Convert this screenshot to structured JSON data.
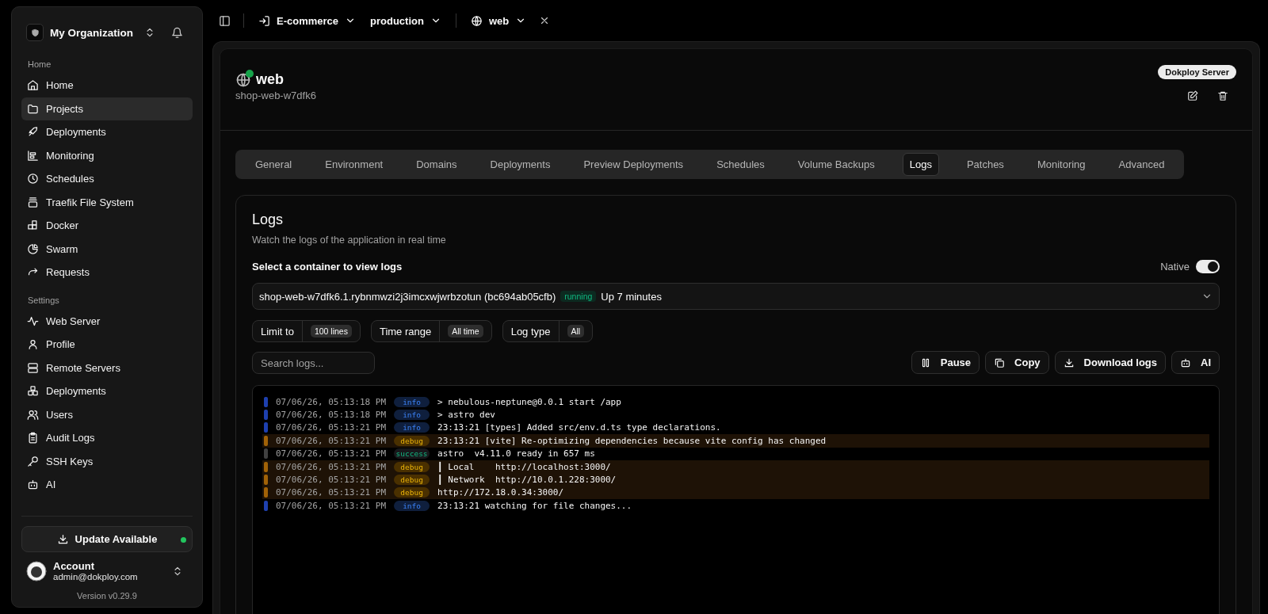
{
  "sidebar": {
    "organization": "My Organization",
    "sections": [
      {
        "title": "Home",
        "items": [
          {
            "label": "Home",
            "selected": false
          },
          {
            "label": "Projects",
            "selected": true
          },
          {
            "label": "Deployments",
            "selected": false
          },
          {
            "label": "Monitoring",
            "selected": false
          },
          {
            "label": "Schedules",
            "selected": false
          },
          {
            "label": "Traefik File System",
            "selected": false
          },
          {
            "label": "Docker",
            "selected": false
          },
          {
            "label": "Swarm",
            "selected": false
          },
          {
            "label": "Requests",
            "selected": false
          }
        ]
      },
      {
        "title": "Settings",
        "items": [
          {
            "label": "Web Server",
            "selected": false
          },
          {
            "label": "Profile",
            "selected": false
          },
          {
            "label": "Remote Servers",
            "selected": false
          },
          {
            "label": "Deployments",
            "selected": false
          },
          {
            "label": "Users",
            "selected": false
          },
          {
            "label": "Audit Logs",
            "selected": false
          },
          {
            "label": "SSH Keys",
            "selected": false
          },
          {
            "label": "AI",
            "selected": false
          }
        ]
      }
    ],
    "update": {
      "label": "Update Available",
      "dot": true
    },
    "account": {
      "name": "Account",
      "email": "admin@dokploy.com"
    },
    "version": "Version v0.29.9"
  },
  "breadcrumb": {
    "project": "E-commerce",
    "environment": "production",
    "service": "web"
  },
  "service": {
    "name": "web",
    "running": true,
    "app_name": "shop-web-w7dfk6",
    "server_badge": "Dokploy Server"
  },
  "tabs": [
    {
      "label": "General",
      "selected": false
    },
    {
      "label": "Environment",
      "selected": false
    },
    {
      "label": "Domains",
      "selected": false
    },
    {
      "label": "Deployments",
      "selected": false
    },
    {
      "label": "Preview Deployments",
      "selected": false
    },
    {
      "label": "Schedules",
      "selected": false
    },
    {
      "label": "Volume Backups",
      "selected": false
    },
    {
      "label": "Logs",
      "selected": true
    },
    {
      "label": "Patches",
      "selected": false
    },
    {
      "label": "Monitoring",
      "selected": false
    },
    {
      "label": "Advanced",
      "selected": false
    }
  ],
  "logs": {
    "title": "Logs",
    "description": "Watch the logs of the application in real time",
    "container_label": "Select a container to view logs",
    "native": {
      "label": "Native",
      "on": true
    },
    "container": {
      "value": "shop-web-w7dfk6.1.rybnmwzi2j3imcxwjwrbzotun (bc694ab05cfb)",
      "status": "running",
      "uptime": "Up 7 minutes"
    },
    "filters": [
      {
        "label": "Limit to",
        "value": "100 lines"
      },
      {
        "label": "Time range",
        "value": "All time"
      },
      {
        "label": "Log type",
        "value": "All"
      }
    ],
    "search": {
      "placeholder": "Search logs..."
    },
    "actions": [
      "Pause",
      "Copy",
      "Download logs",
      "AI"
    ],
    "lines": [
      {
        "time": "07/06/26, 05:13:18 PM",
        "type": "info",
        "message": "> nebulous-neptune@0.0.1 start /app"
      },
      {
        "time": "07/06/26, 05:13:18 PM",
        "type": "info",
        "message": "> astro dev"
      },
      {
        "time": "07/06/26, 05:13:21 PM",
        "type": "info",
        "message": "23:13:21 [types] Added src/env.d.ts type declarations."
      },
      {
        "time": "07/06/26, 05:13:21 PM",
        "type": "debug",
        "message": "23:13:21 [vite] Re-optimizing dependencies because vite config has changed"
      },
      {
        "time": "07/06/26, 05:13:21 PM",
        "type": "success",
        "message": "astro  v4.11.0 ready in 657 ms"
      },
      {
        "time": "07/06/26, 05:13:21 PM",
        "type": "debug",
        "message": "┃ Local    http://localhost:3000/"
      },
      {
        "time": "07/06/26, 05:13:21 PM",
        "type": "debug",
        "message": "┃ Network  http://10.0.1.228:3000/"
      },
      {
        "time": "07/06/26, 05:13:21 PM",
        "type": "debug",
        "message": "http://172.18.0.34:3000/"
      },
      {
        "time": "07/06/26, 05:13:21 PM",
        "type": "info",
        "message": "23:13:21 watching for file changes..."
      }
    ]
  }
}
